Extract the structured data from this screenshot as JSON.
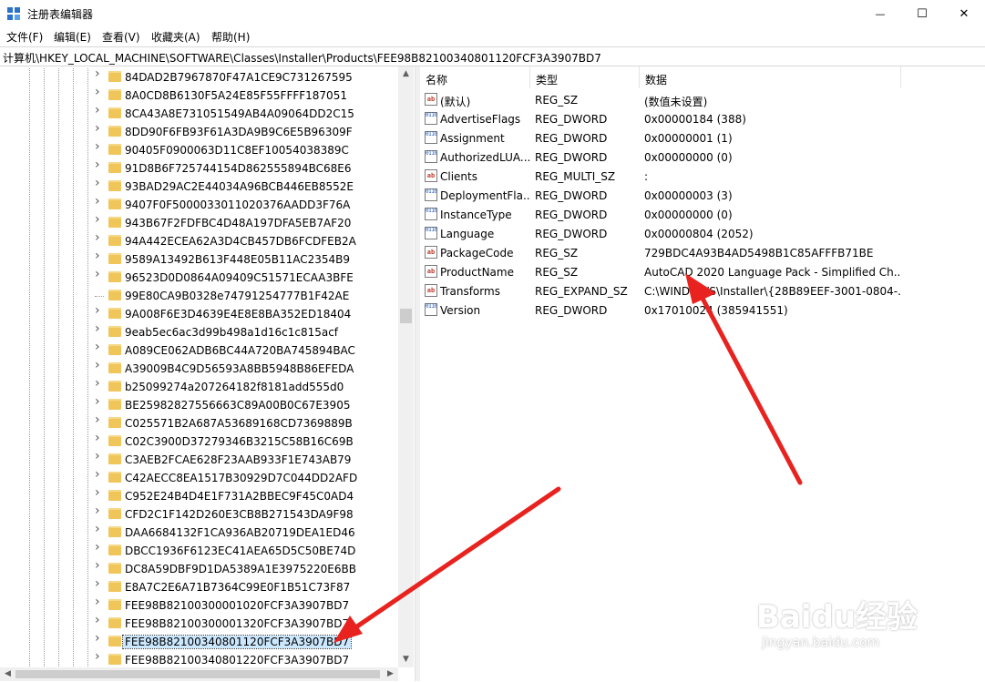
{
  "window": {
    "title": "注册表编辑器",
    "controls": {
      "minimize": "—",
      "maximize": "☐",
      "close": "✕"
    },
    "icon": "regedit-icon"
  },
  "menu": [
    "文件(F)",
    "编辑(E)",
    "查看(V)",
    "收藏夹(A)",
    "帮助(H)"
  ],
  "address": "计算机\\HKEY_LOCAL_MACHINE\\SOFTWARE\\Classes\\Installer\\Products\\FEE98B82100340801120FCF3A3907BD7",
  "tree": {
    "items": [
      {
        "label": "84DAD2B7967870F47A1CE9C731267595",
        "expand": true
      },
      {
        "label": "8A0CD8B6130F5A24E85F55FFFF187051",
        "expand": true
      },
      {
        "label": "8CA43A8E731051549AB4A09064DD2C15",
        "expand": true
      },
      {
        "label": "8DD90F6FB93F61A3DA9B9C6E5B96309F",
        "expand": true
      },
      {
        "label": "90405F0900063D11C8EF10054038389C",
        "expand": true
      },
      {
        "label": "91D8B6F725744154D862555894BC68E6",
        "expand": true
      },
      {
        "label": "93BAD29AC2E44034A96BCB446EB8552E",
        "expand": true
      },
      {
        "label": "9407F0F5000033011020376AADD3F76A",
        "expand": true
      },
      {
        "label": "943B67F2FDFBC4D48A197DFA5EB7AF20",
        "expand": true
      },
      {
        "label": "94A442ECEA62A3D4CB457DB6FCDFEB2A",
        "expand": true
      },
      {
        "label": "9589A13492B613F448E05B11AC2354B9",
        "expand": true
      },
      {
        "label": "96523D0D0864A09409C51571ECAA3BFE",
        "expand": true
      },
      {
        "label": "99E80CA9B0328e74791254777B1F42AE",
        "expand": false
      },
      {
        "label": "9A008F6E3D4639E4E8E8BA352ED18404",
        "expand": true
      },
      {
        "label": "9eab5ec6ac3d99b498a1d16c1c815acf",
        "expand": true
      },
      {
        "label": "A089CE062ADB6BC44A720BA745894BAC",
        "expand": true
      },
      {
        "label": "A39009B4C9D56593A8BB5948B86EFEDA",
        "expand": true
      },
      {
        "label": "b25099274a207264182f8181add555d0",
        "expand": true
      },
      {
        "label": "BE25982827556663C89A00B0C67E3905",
        "expand": true
      },
      {
        "label": "C025571B2A687A53689168CD7369889B",
        "expand": true
      },
      {
        "label": "C02C3900D37279346B3215C58B16C69B",
        "expand": true
      },
      {
        "label": "C3AEB2FCAE628F23AAB933F1E743AB79",
        "expand": true
      },
      {
        "label": "C42AECC8EA1517B30929D7C044DD2AFD",
        "expand": true
      },
      {
        "label": "C952E24B4D4E1F731A2BBEC9F45C0AD4",
        "expand": true
      },
      {
        "label": "CFD2C1F142D260E3CB8B271543DA9F98",
        "expand": true
      },
      {
        "label": "DAA6684132F1CA936AB20719DEA1ED46",
        "expand": true
      },
      {
        "label": "DBCC1936F6123EC41AEA65D5C50BE74D",
        "expand": true
      },
      {
        "label": "DC8A59DBF9D1DA5389A1E3975220E6BB",
        "expand": true
      },
      {
        "label": "E8A7C2E6A71B7364C99E0F1B51C73F87",
        "expand": true
      },
      {
        "label": "FEE98B82100300001020FCF3A3907BD7",
        "expand": true
      },
      {
        "label": "FEE98B82100300001320FCF3A3907BD7",
        "expand": true
      },
      {
        "label": "FEE98B82100340801120FCF3A3907BD7",
        "expand": true,
        "selected": true
      },
      {
        "label": "FEE98B82100340801220FCF3A3907BD7",
        "expand": true
      }
    ]
  },
  "values": {
    "headers": {
      "name": "名称",
      "type": "类型",
      "data": "数据"
    },
    "rows": [
      {
        "icon": "sz",
        "name": "(默认)",
        "type": "REG_SZ",
        "data": "(数值未设置)"
      },
      {
        "icon": "bin",
        "name": "AdvertiseFlags",
        "type": "REG_DWORD",
        "data": "0x00000184 (388)"
      },
      {
        "icon": "bin",
        "name": "Assignment",
        "type": "REG_DWORD",
        "data": "0x00000001 (1)"
      },
      {
        "icon": "bin",
        "name": "AuthorizedLUA...",
        "type": "REG_DWORD",
        "data": "0x00000000 (0)"
      },
      {
        "icon": "sz",
        "name": "Clients",
        "type": "REG_MULTI_SZ",
        "data": ":"
      },
      {
        "icon": "bin",
        "name": "DeploymentFla...",
        "type": "REG_DWORD",
        "data": "0x00000003 (3)"
      },
      {
        "icon": "bin",
        "name": "InstanceType",
        "type": "REG_DWORD",
        "data": "0x00000000 (0)"
      },
      {
        "icon": "bin",
        "name": "Language",
        "type": "REG_DWORD",
        "data": "0x00000804 (2052)"
      },
      {
        "icon": "sz",
        "name": "PackageCode",
        "type": "REG_SZ",
        "data": "729BDC4A93B4AD5498B1C85AFFFB71BE"
      },
      {
        "icon": "sz",
        "name": "ProductName",
        "type": "REG_SZ",
        "data": "AutoCAD 2020 Language Pack - Simplified Ch..."
      },
      {
        "icon": "sz",
        "name": "Transforms",
        "type": "REG_EXPAND_SZ",
        "data": "C:\\WINDOWS\\Installer\\{28B89EEF-3001-0804-..."
      },
      {
        "icon": "bin",
        "name": "Version",
        "type": "REG_DWORD",
        "data": "0x17010024 (385941551)"
      }
    ]
  },
  "annotation_colors": {
    "arrow": "#e8231f"
  },
  "watermark": {
    "brand": "Baidu经验",
    "url": "jingyan.baidu.com"
  }
}
